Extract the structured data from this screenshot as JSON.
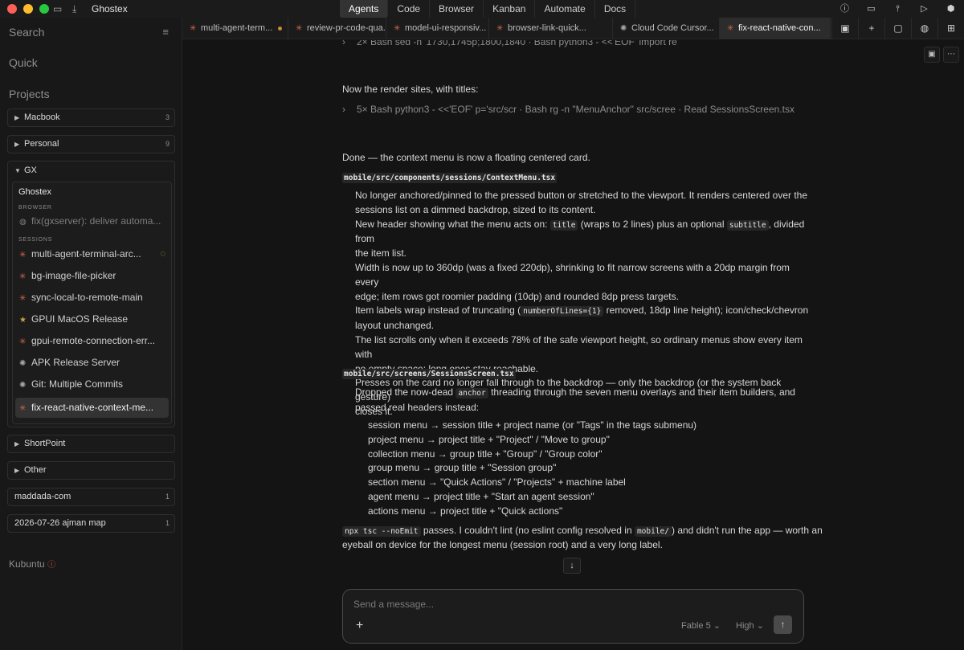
{
  "window": {
    "app_name": "Ghostex",
    "traffic_colors": [
      "#ff5f57",
      "#febc2e",
      "#28c840"
    ]
  },
  "top_tabs": [
    "Agents",
    "Code",
    "Browser",
    "Kanban",
    "Automate",
    "Docs"
  ],
  "top_right_icons": [
    "info-badge-icon",
    "monitor-icon",
    "branch-icon",
    "play-icon",
    "cube-icon"
  ],
  "sidebar": {
    "search_label": "Search",
    "quick_label": "Quick",
    "projects_label": "Projects",
    "projects_top": [
      {
        "name": "Macbook",
        "count": "3"
      },
      {
        "name": "Personal",
        "count": "9"
      }
    ],
    "gx": {
      "name": "GX",
      "machine": "Ghostex",
      "browser_label": "BROWSER",
      "browser_item": "fix(gxserver): deliver automa...",
      "sessions_label": "SESSIONS",
      "sessions": [
        {
          "title": "multi-agent-terminal-arc...",
          "icon": "asterisk-icon"
        },
        {
          "title": "bg-image-file-picker",
          "icon": "asterisk-icon"
        },
        {
          "title": "sync-local-to-remote-main",
          "icon": "asterisk-icon"
        },
        {
          "title": "GPUI MacOS Release",
          "icon": "star-icon"
        },
        {
          "title": "gpui-remote-connection-err...",
          "icon": "asterisk-icon"
        },
        {
          "title": "APK Release Server",
          "icon": "openai-icon"
        },
        {
          "title": "Git: Multiple Commits",
          "icon": "openai-icon"
        },
        {
          "title": "fix-react-native-context-me...",
          "icon": "asterisk-icon"
        }
      ]
    },
    "projects_bottom": [
      {
        "name": "ShortPoint",
        "count": "",
        "caret": true
      },
      {
        "name": "Other",
        "count": "",
        "caret": true
      },
      {
        "name": "maddada-com",
        "count": "1",
        "caret": false
      },
      {
        "name": "2026-07-26 ajman map",
        "count": "1",
        "caret": false
      }
    ],
    "machine2": "Kubuntu"
  },
  "session_tabs": [
    {
      "title": "multi-agent-term...",
      "icon": "asterisk-icon",
      "unread": true
    },
    {
      "title": "review-pr-code-qua...",
      "icon": "asterisk-icon",
      "unread": false
    },
    {
      "title": "model-ui-responsiv...",
      "icon": "asterisk-icon",
      "unread": false
    },
    {
      "title": "browser-link-quick...",
      "icon": "asterisk-icon",
      "unread": false
    },
    {
      "title": "Cloud Code Cursor...",
      "icon": "openai-icon",
      "unread": false
    },
    {
      "title": "fix-react-native-con...",
      "icon": "asterisk-icon",
      "unread": false
    }
  ],
  "conversation": {
    "tool_1": "2× Bash sed -n '1730,1745p;1800,1840 · Bash python3 - <<'EOF' import re",
    "intro": "Now the render sites, with titles:",
    "tool_2": "5× Bash python3 - <<'EOF' p='src/scr · Bash rg -n \"MenuAnchor\" src/scree · Read SessionsScreen.tsx",
    "done": "Done — the context menu is now a floating centered card.",
    "file_1": "mobile/src/components/sessions/ContextMenu.tsx",
    "f1_p1_l1": "No longer anchored/pinned to the pressed button or stretched to the viewport. It renders centered over the",
    "f1_p1_l2": "sessions list on a dimmed backdrop, sized to its content.",
    "f1_p2_pre": "New header showing what the menu acts on: ",
    "f1_p2_code1": "title",
    "f1_p2_mid": " (wraps to 2 lines) plus an optional ",
    "f1_p2_code2": "subtitle",
    "f1_p2_post": ", divided from",
    "f1_p2_l2": "the item list.",
    "f1_p3_l1": "Width is now up to 360dp (was a fixed 220dp), shrinking to fit narrow screens with a 20dp margin from every",
    "f1_p3_l2": "edge; item rows got roomier padding (10dp) and rounded 8dp press targets.",
    "f1_p4_pre": "Item labels wrap instead of truncating (",
    "f1_p4_code": "numberOfLines={1}",
    "f1_p4_post": " removed, 18dp line height); icon/check/chevron",
    "f1_p4_l2": "layout unchanged.",
    "f1_p5_l1": "The list scrolls only when it exceeds 78% of the safe viewport height, so ordinary menus show every item with",
    "f1_p5_l2": "no empty space; long ones stay reachable.",
    "f1_p6_l1": "Presses on the card no longer fall through to the backdrop — only the backdrop (or the system back gesture)",
    "f1_p6_l2": "closes it.",
    "file_2": "mobile/src/screens/SessionsScreen.tsx",
    "f2_p1_pre": "Dropped the now-dead ",
    "f2_p1_code": "anchor",
    "f2_p1_post": " threading through the seven menu overlays and their item builders, and",
    "f2_p1_l2": "passed real headers instead:",
    "menus": [
      "session menu → session title + project name (or \"Tags\" in the tags submenu)",
      "project menu → project title + \"Project\" / \"Move to group\"",
      "collection menu → group title + \"Group\" / \"Group color\"",
      "group menu → group title + \"Session group\"",
      "section menu → \"Quick Actions\" / \"Projects\" + machine label",
      "agent menu → project title + \"Start an agent session\"",
      "actions menu → project title + \"Quick actions\""
    ],
    "final_code1": "npx tsc --noEmit",
    "final_mid": " passes. I couldn't lint (no eslint config resolved in ",
    "final_code2": "mobile/",
    "final_post": ") and didn't run the app — worth an",
    "final_l2": "eyeball on device for the longest menu (session root) and a very long label."
  },
  "composer": {
    "placeholder": "Send a message...",
    "model": "Fable 5",
    "effort": "High"
  }
}
